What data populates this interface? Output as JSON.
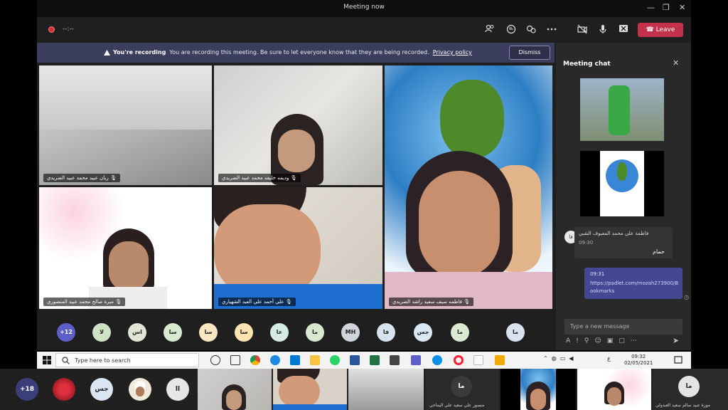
{
  "window": {
    "title": "Meeting now",
    "minimize": "—",
    "maximize": "❐",
    "close": "✕"
  },
  "toolbar": {
    "timer": "--:--",
    "leave_label": "Leave"
  },
  "banner": {
    "title": "You're recording",
    "text": "You are recording this meeting. Be sure to let everyone know that they are being recorded.",
    "link": "Privacy policy",
    "dismiss_label": "Dismiss"
  },
  "participants": [
    "ريان عبيد محمد عبيد الضريدي",
    "وديمه خليفه محمد عبيد الضريدي",
    "فاطمه سيف سعيد راشد الضريدي",
    "ميرة صالح محمد عبيد المنصوري",
    "علي أحمد علي العبد الشهياري"
  ],
  "roster": {
    "overflow": "+12",
    "avatars": [
      "لا",
      "اس",
      "سا",
      "سا",
      "سا",
      "عا",
      "ما",
      "MH",
      "فا",
      "جس",
      "ما"
    ],
    "last": "ما"
  },
  "chat": {
    "header": "Meeting chat",
    "close": "✕",
    "sender": "فاطمة علي محمد المعيوف النقبي",
    "sender_initials": "فا",
    "time1": "09:30",
    "msg1": "حمام",
    "time2": "09:31",
    "link": "https://padlet.com/mozah273900/Bookmarks",
    "input_placeholder": "Type a new message"
  },
  "taskbar": {
    "search_placeholder": "Type here to search",
    "time": "09:32",
    "date": "02/05/2021",
    "lang": "ع"
  },
  "strip": {
    "overflow": "+18",
    "initials1": "جس",
    "initials2": "اا",
    "initials3": "ما",
    "name1": "منصور علي سعيد علي اليماحي",
    "initials4": "ما",
    "name2": "موزة عبيد سالم سعيد العبدولي"
  },
  "colors": {
    "leave": "#c4314b",
    "banner": "#3b3d5c",
    "record": "#d13438"
  }
}
